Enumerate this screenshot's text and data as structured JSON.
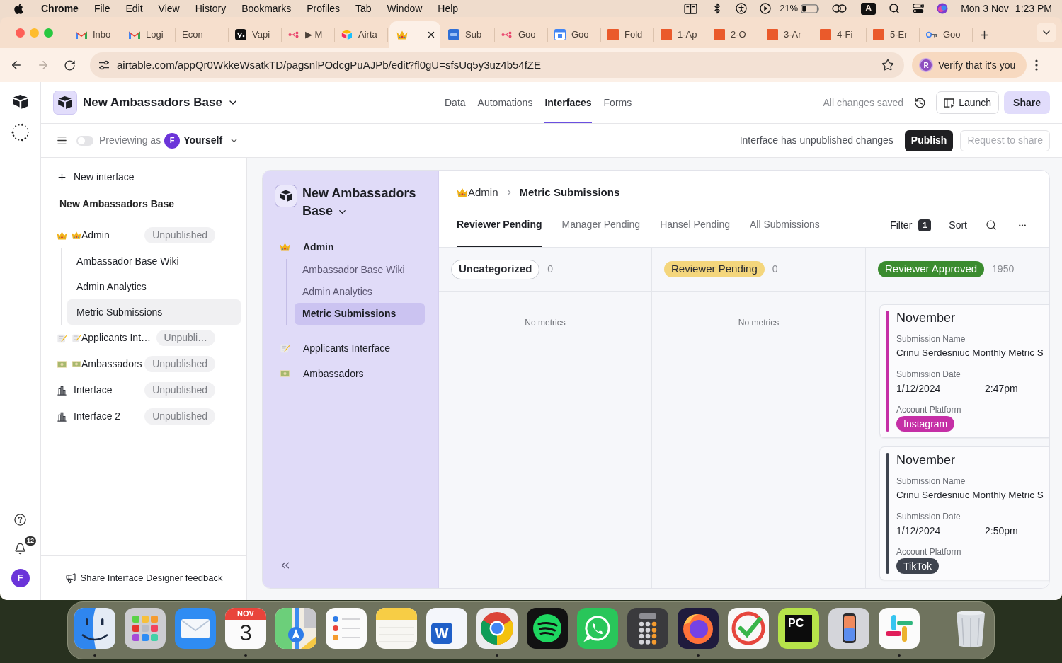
{
  "menu_bar": {
    "app_name": "Chrome",
    "menus": [
      "File",
      "Edit",
      "View",
      "History",
      "Bookmarks",
      "Profiles",
      "Tab",
      "Window",
      "Help"
    ],
    "battery_text": "21%",
    "input_source": "A",
    "date": "Mon 3 Nov",
    "time": "1:23 PM"
  },
  "browser": {
    "tabs": [
      {
        "title": "Inbo",
        "kind": "gmail",
        "selected": false
      },
      {
        "title": "Logi",
        "kind": "gmail",
        "selected": false
      },
      {
        "title": "Econ",
        "kind": "blank",
        "selected": false
      },
      {
        "title": "Vapi",
        "kind": "vapi",
        "selected": false
      },
      {
        "title": "▶ M",
        "kind": "flow",
        "selected": false
      },
      {
        "title": "Airta",
        "kind": "airtable",
        "selected": false
      },
      {
        "kind": "crown",
        "selected": true
      },
      {
        "title": "Sub",
        "kind": "su",
        "selected": false
      },
      {
        "title": "Goo",
        "kind": "flow",
        "selected": false
      },
      {
        "title": "Goo",
        "kind": "calendar",
        "selected": false
      },
      {
        "title": "Fold",
        "kind": "square",
        "selected": false
      },
      {
        "title": "1-Ap",
        "kind": "square",
        "selected": false
      },
      {
        "title": "2-O",
        "kind": "square",
        "selected": false
      },
      {
        "title": "3-Ar",
        "kind": "square",
        "selected": false
      },
      {
        "title": "4-Fi",
        "kind": "square",
        "selected": false
      },
      {
        "title": "5-Er",
        "kind": "square",
        "selected": false
      },
      {
        "title": "Goo",
        "kind": "key",
        "selected": false
      }
    ],
    "address": "airtable.com/appQr0WkkeWsatkTD/pagsnlPOdcgPuAJPb/edit?fl0gU=sfsUq5y3uz4b54fZE",
    "profile_avatar": "R",
    "profile_label": "Verify that it's you"
  },
  "app": {
    "rail": {
      "notification_count": "12",
      "avatar": "F"
    },
    "header": {
      "base_name": "New Ambassadors Base",
      "nav": [
        {
          "label": "Data",
          "selected": false
        },
        {
          "label": "Automations",
          "selected": false
        },
        {
          "label": "Interfaces",
          "selected": true
        },
        {
          "label": "Forms",
          "selected": false
        }
      ],
      "save_status": "All changes saved",
      "launch": "Launch",
      "share": "Share"
    },
    "preview_bar": {
      "preview_on": false,
      "label": "Previewing as",
      "avatar": "F",
      "user": "Yourself",
      "notice": "Interface has unpublished changes",
      "publish": "Publish",
      "request_share": {
        "label": "Request to share",
        "disabled": true
      }
    },
    "sidebar": {
      "new_interface": "New interface",
      "base_name": "New Ambassadors Base",
      "items": [
        {
          "kind": "crown",
          "label": "Admin",
          "status": "Unpublished",
          "selected": false,
          "children": [
            {
              "label": "Ambassador Base Wiki",
              "selected": false
            },
            {
              "label": "Admin Analytics",
              "selected": false
            },
            {
              "label": "Metric Submissions",
              "selected": true
            }
          ]
        },
        {
          "kind": "memo",
          "label": "Applicants Int…",
          "status": "Unpubli…",
          "selected": false
        },
        {
          "kind": "banknote",
          "label": "Ambassadors",
          "status": "Unpublished",
          "selected": false
        },
        {
          "kind": "chart",
          "label": "Interface",
          "status": "Unpublished",
          "selected": false
        },
        {
          "kind": "chart",
          "label": "Interface 2",
          "status": "Unpublished",
          "selected": false
        }
      ],
      "feedback": "Share Interface Designer feedback"
    },
    "preview": {
      "base_name": "New Ambassadors Base",
      "nav": [
        {
          "kind": "crown",
          "label": "Admin",
          "selected": false,
          "children": [
            {
              "label": "Ambassador Base Wiki",
              "selected": false
            },
            {
              "label": "Admin Analytics",
              "selected": false
            },
            {
              "label": "Metric Submissions",
              "selected": true
            }
          ]
        },
        {
          "kind": "memo",
          "label": "Applicants Interface",
          "selected": false
        },
        {
          "kind": "banknote",
          "label": "Ambassadors",
          "selected": false
        }
      ],
      "breadcrumb": [
        {
          "kind": "crown",
          "label": "Admin"
        },
        {
          "kind": "plain",
          "label": "Metric Submissions"
        }
      ],
      "tabs": [
        {
          "label": "Reviewer Pending",
          "selected": true
        },
        {
          "label": "Manager Pending",
          "selected": false
        },
        {
          "label": "Hansel Pending",
          "selected": false
        },
        {
          "label": "All Submissions",
          "selected": false
        }
      ],
      "toolbar": {
        "filter": "Filter",
        "filter_count": "1",
        "sort": "Sort"
      },
      "columns": [
        {
          "title": "Uncategorized",
          "kind": "outline",
          "color": "#ffffff",
          "count": "0",
          "empty_text": "No metrics"
        },
        {
          "title": "Reviewer Pending",
          "kind": "solid",
          "color": "#f4d67c",
          "count": "0",
          "empty_text": "No metrics"
        },
        {
          "title": "Reviewer Approved",
          "kind": "solid",
          "color": "#3b8c2f",
          "count": "1950",
          "cards": [
            {
              "title": "November",
              "color": "#c52fa6",
              "fields": [
                {
                  "kind": "text",
                  "label": "Submission Name",
                  "value": "Crinu Serdesniuc Monthly Metric S"
                },
                {
                  "kind": "datetime",
                  "label": "Submission Date",
                  "value": "1/12/2024",
                  "time": "2:47pm"
                },
                {
                  "kind": "tag",
                  "label": "Account Platform",
                  "value": "Instagram"
                }
              ]
            },
            {
              "title": "November",
              "color": "#3f444f",
              "fields": [
                {
                  "kind": "text",
                  "label": "Submission Name",
                  "value": "Crinu Serdesniuc Monthly Metric S"
                },
                {
                  "kind": "datetime",
                  "label": "Submission Date",
                  "value": "1/12/2024",
                  "time": "2:50pm"
                },
                {
                  "kind": "tag",
                  "label": "Account Platform",
                  "value": "TikTok"
                }
              ]
            }
          ]
        }
      ]
    }
  },
  "dock": [
    {
      "kind": "finder",
      "running": true
    },
    {
      "kind": "launchpad",
      "running": false
    },
    {
      "kind": "mail",
      "running": false
    },
    {
      "kind": "calendar",
      "month": "NOV",
      "day": "3",
      "running": true
    },
    {
      "kind": "maps",
      "running": false
    },
    {
      "kind": "reminders",
      "running": false
    },
    {
      "kind": "notes",
      "running": false
    },
    {
      "kind": "word",
      "letter": "W",
      "running": false
    },
    {
      "kind": "chrome",
      "running": true
    },
    {
      "kind": "spotify",
      "running": false
    },
    {
      "kind": "whatsapp",
      "running": false
    },
    {
      "kind": "calculator",
      "running": false
    },
    {
      "kind": "firefox",
      "running": true
    },
    {
      "kind": "ticktick",
      "running": false
    },
    {
      "kind": "pycharm",
      "letters": "PC",
      "running": false
    },
    {
      "kind": "phone",
      "running": false
    },
    {
      "kind": "slack",
      "running": true
    },
    {
      "kind": "trash",
      "running": false
    }
  ]
}
